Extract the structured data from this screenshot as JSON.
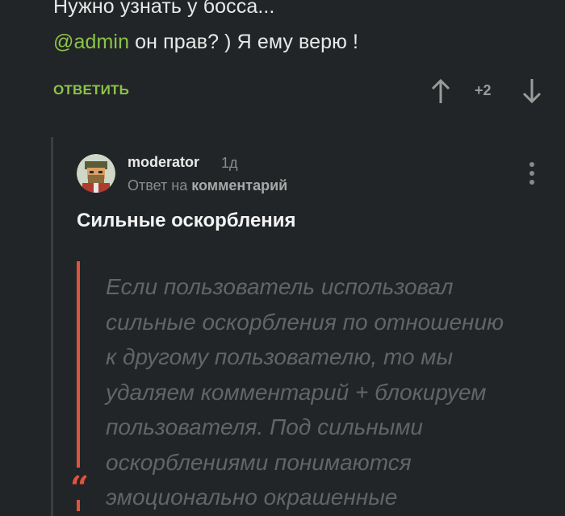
{
  "parent_comment": {
    "line1": "Нужно узнать у босса...",
    "mention": "@admin",
    "line2_rest": " он прав? ) Я ему верю !"
  },
  "actions": {
    "reply_label": "ОТВЕТИТЬ",
    "vote_count": "+2",
    "upvote_icon": "arrow-up-icon",
    "downvote_icon": "arrow-down-icon"
  },
  "reply_comment": {
    "author": "moderator",
    "time": "1д",
    "reply_prefix": "Ответ на ",
    "reply_target": "комментарий",
    "title": "Сильные оскорбления",
    "quote_lines": [
      "Если пользователь использовал",
      "сильные оскорбления по отношению",
      "к другому пользователю, то мы",
      "удаляем комментарий + блокируем",
      "пользователя. Под сильными",
      "оскорблениями понимаются",
      "эмоционально окрашенные"
    ],
    "quote_mark": "“"
  },
  "colors": {
    "background": "#222527",
    "accent_green": "#8bc34a",
    "quote_red": "#e0533f",
    "muted_text": "#8a8a8a"
  }
}
